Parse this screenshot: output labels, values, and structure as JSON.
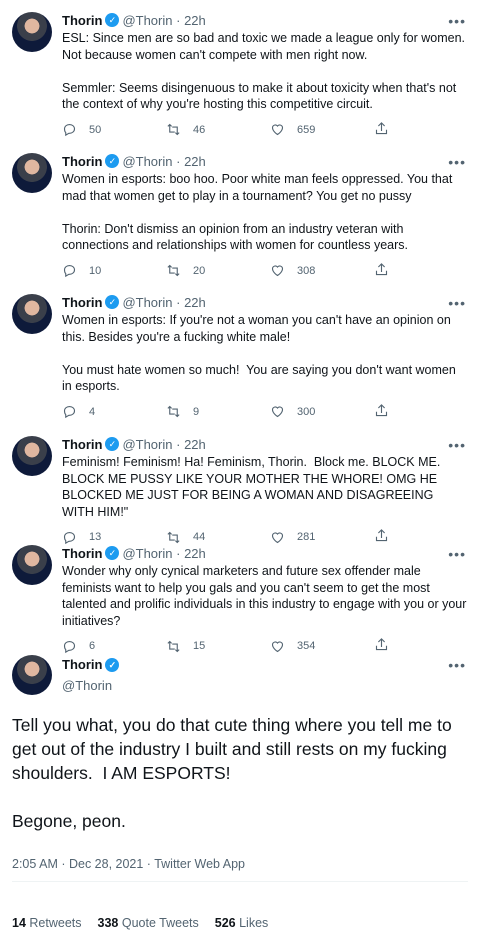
{
  "tweets": [
    {
      "name": "Thorin",
      "handle": "@Thorin",
      "dot": "·",
      "time": "22h",
      "text": "ESL: Since men are so bad and toxic we made a league only for women. Not because women can't compete with men right now.\n\nSemmler: Seems disingenuous to make it about toxicity when that's not the context of why you're hosting this competitive circuit.",
      "replies": "50",
      "retweets": "46",
      "likes": "659"
    },
    {
      "name": "Thorin",
      "handle": "@Thorin",
      "dot": "·",
      "time": "22h",
      "text": "Women in esports: boo hoo. Poor white man feels oppressed. You that mad that women get to play in a tournament? You get no pussy\n\nThorin: Don't dismiss an opinion from an industry veteran with connections and relationships with women for countless years.",
      "replies": "10",
      "retweets": "20",
      "likes": "308"
    },
    {
      "name": "Thorin",
      "handle": "@Thorin",
      "dot": "·",
      "time": "22h",
      "text": "Women in esports: If you're not a woman you can't have an opinion on this. Besides you're a fucking white male!\n\nYou must hate women so much!  You are saying you don't want women in esports.",
      "replies": "4",
      "retweets": "9",
      "likes": "300"
    },
    {
      "name": "Thorin",
      "handle": "@Thorin",
      "dot": "·",
      "time": "22h",
      "text": "Feminism! Feminism! Ha! Feminism, Thorin.  Block me. BLOCK ME. BLOCK ME PUSSY LIKE YOUR MOTHER THE WHORE! OMG HE BLOCKED ME JUST FOR BEING A WOMAN AND DISAGREEING WITH HIM!\"",
      "replies": "13",
      "retweets": "44",
      "likes": "281"
    },
    {
      "name": "Thorin",
      "handle": "@Thorin",
      "dot": "·",
      "time": "22h",
      "text": "Wonder why only cynical marketers and future sex offender male feminists want to help you gals and you can't seem to get the most talented and prolific individuals in this industry to engage with you or your initiatives?",
      "replies": "6",
      "retweets": "15",
      "likes": "354"
    }
  ],
  "main": {
    "name": "Thorin",
    "handle": "@Thorin",
    "text": "Tell you what, you do that cute thing where you tell me to get out of the industry I built and still rests on my fucking shoulders.  I AM ESPORTS!\n\nBegone, peon.",
    "meta": "2:05 AM · Dec 28, 2021 · Twitter Web App",
    "retweets_count": "14",
    "retweets_label": "Retweets",
    "quotes_count": "338",
    "quotes_label": "Quote Tweets",
    "likes_count": "526",
    "likes_label": "Likes"
  },
  "icons": {
    "verified": "verified-badge-icon",
    "more": "more-icon",
    "reply": "reply-icon",
    "retweet": "retweet-icon",
    "like": "like-icon",
    "share": "share-icon"
  },
  "colors": {
    "accent": "#1d9bf0",
    "secondary": "#536471",
    "text": "#0f1419"
  }
}
